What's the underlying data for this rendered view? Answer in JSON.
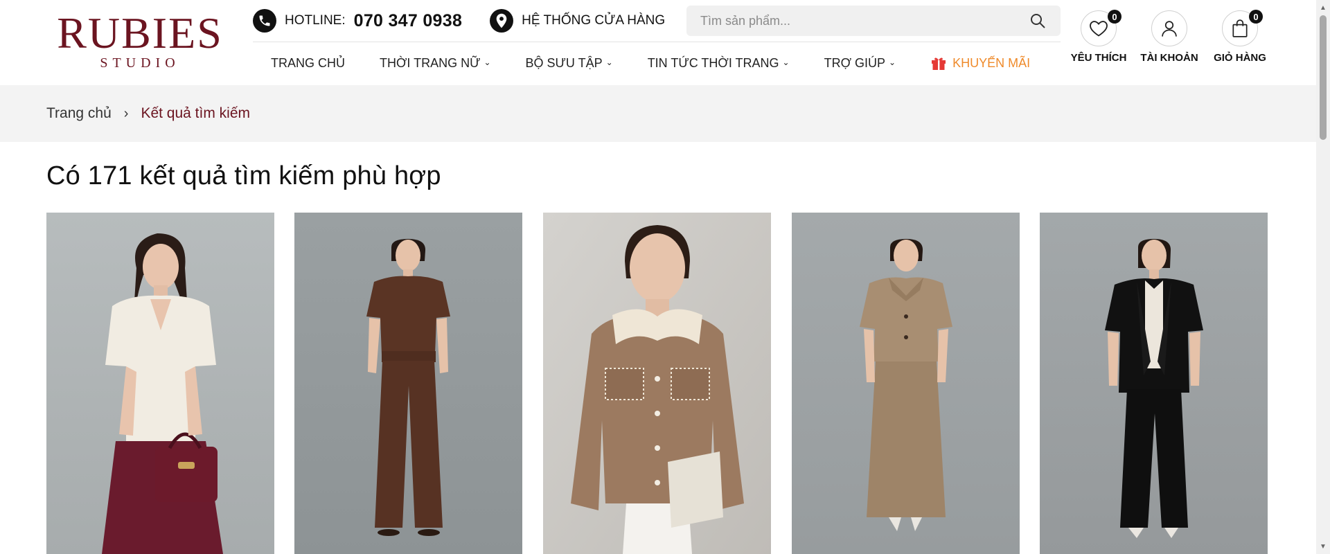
{
  "brand": {
    "name": "RUBIES",
    "sub": "STUDIO",
    "color": "#6b1420"
  },
  "topbar": {
    "hotline_label": "HOTLINE:",
    "hotline_number": "070 347 0938",
    "stores_label": "HỆ THỐNG CỬA HÀNG"
  },
  "search": {
    "placeholder": "Tìm sản phẩm...",
    "value": ""
  },
  "nav": {
    "items": [
      {
        "label": "TRANG CHỦ"
      },
      {
        "label": "THỜI TRANG NỮ"
      },
      {
        "label": "BỘ SƯU TẬP"
      },
      {
        "label": "TIN TỨC THỜI TRANG"
      },
      {
        "label": "TRỢ GIÚP"
      }
    ],
    "promo_label": "KHUYẾN MÃI",
    "chevron": "⌄"
  },
  "user_actions": {
    "wishlist": {
      "label": "YÊU THÍCH",
      "count": "0",
      "icon": "heart-icon"
    },
    "account": {
      "label": "TÀI KHOẢN",
      "icon": "user-icon"
    },
    "cart": {
      "label": "GIỎ HÀNG",
      "count": "0",
      "icon": "bag-icon"
    }
  },
  "breadcrumb": {
    "home": "Trang chủ",
    "separator": "›",
    "current": "Kết quả tìm kiếm"
  },
  "results": {
    "title": "Có 171 kết quả tìm kiếm phù hợp"
  },
  "products": [
    {
      "name": "cream knit top with burgundy skirt"
    },
    {
      "name": "brown top and wide trousers"
    },
    {
      "name": "camel jacket with cream collar"
    },
    {
      "name": "beige shirt jacket and maxi skirt"
    },
    {
      "name": "black blazer and black trousers"
    }
  ],
  "colors": {
    "accent": "#6b1420",
    "promo": "#ef8a2a",
    "breadcrumb_bg": "#f3f3f3"
  }
}
